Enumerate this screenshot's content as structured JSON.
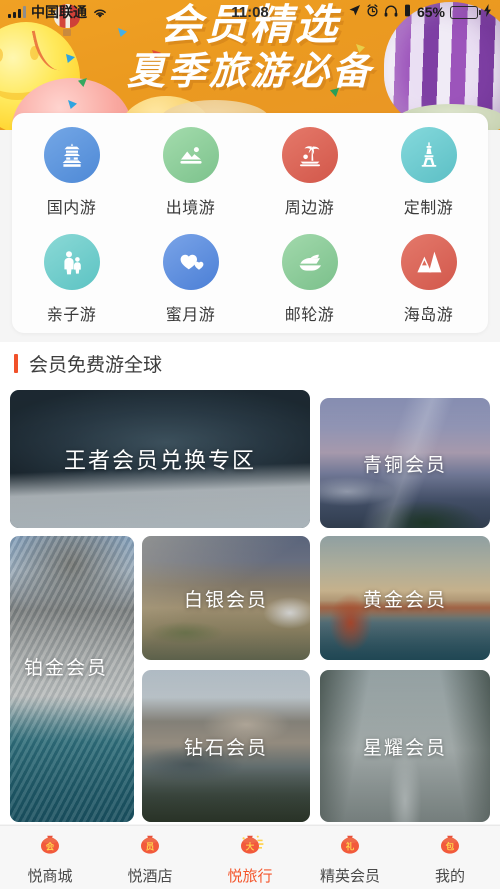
{
  "status_bar": {
    "carrier": "中国联通",
    "time": "11:08",
    "battery_percent": "65%",
    "battery_level": 65,
    "icons": [
      "signal-icon",
      "wifi-icon",
      "location-icon",
      "alarm-icon",
      "headphones-icon",
      "vibrate-icon",
      "battery-icon",
      "charging-icon"
    ]
  },
  "banner": {
    "line1": "会员精选",
    "line2": "夏季旅游必备",
    "background_color": "#eb9a20"
  },
  "quick_nav": {
    "rows": [
      [
        {
          "label": "国内游",
          "icon": "pagoda-icon",
          "color": "#5a93dd"
        },
        {
          "label": "出境游",
          "icon": "mountain-photo-icon",
          "color": "#8dcb9b"
        },
        {
          "label": "周边游",
          "icon": "palm-tree-icon",
          "color": "#dc6a5a"
        },
        {
          "label": "定制游",
          "icon": "eiffel-tower-icon",
          "color": "#6ecbcf"
        }
      ],
      [
        {
          "label": "亲子游",
          "icon": "family-icon",
          "color": "#72cbcb"
        },
        {
          "label": "蜜月游",
          "icon": "hearts-icon",
          "color": "#5c8fe0"
        },
        {
          "label": "邮轮游",
          "icon": "cruise-ship-icon",
          "color": "#8ecb9c"
        },
        {
          "label": "海岛游",
          "icon": "island-mountains-icon",
          "color": "#dd6b5b"
        }
      ]
    ]
  },
  "section": {
    "title": "会员免费游全球",
    "accent_color": "#f1512a"
  },
  "member_cards": [
    {
      "label": "王者会员兑换专区",
      "photo": "icelandic-waterfall"
    },
    {
      "label": "青铜会员",
      "photo": "mountain-dusk"
    },
    {
      "label": "铂金会员",
      "photo": "coastal-city"
    },
    {
      "label": "白银会员",
      "photo": "landmannalaugar"
    },
    {
      "label": "黄金会员",
      "photo": "golden-gate-bridge"
    },
    {
      "label": "钻石会员",
      "photo": "coastal-rocks"
    },
    {
      "label": "星耀会员",
      "photo": "snowy-forest-road"
    }
  ],
  "tabbar": {
    "active_color": "#f4562c",
    "items": [
      {
        "label": "悦商城",
        "badge_char": "会",
        "active": false
      },
      {
        "label": "悦酒店",
        "badge_char": "员",
        "active": false
      },
      {
        "label": "悦旅行",
        "badge_char": "大",
        "active": true
      },
      {
        "label": "精英会员",
        "badge_char": "礼",
        "active": false
      },
      {
        "label": "我的",
        "badge_char": "包",
        "active": false
      }
    ]
  }
}
